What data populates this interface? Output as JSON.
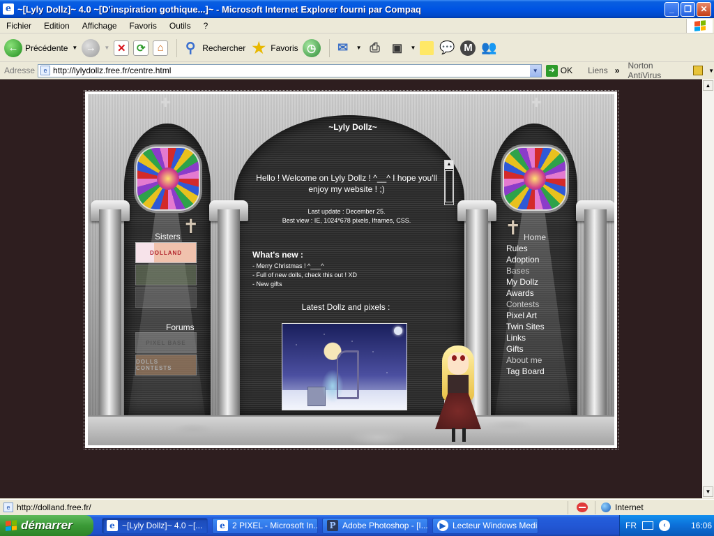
{
  "window": {
    "title": "~[Lyly Dollz]~ 4.0 ~[D'inspiration gothique...]~ - Microsoft Internet Explorer fourni par Compaq"
  },
  "menu": [
    "Fichier",
    "Edition",
    "Affichage",
    "Favoris",
    "Outils",
    "?"
  ],
  "toolbar": {
    "back_label": "Précédente",
    "search_label": "Rechercher",
    "favorites_label": "Favoris"
  },
  "address": {
    "label": "Adresse",
    "url": "http://lylydollz.free.fr/centre.html",
    "go_label": "OK",
    "links_label": "Liens",
    "norton_label": "Norton AntiVirus"
  },
  "page": {
    "site_title": "~Lyly Dollz~",
    "welcome": "Hello ! Welcome on Lyly Dollz ! ^__^ I hope you'll enjoy my website ! ;)",
    "last_update": "Last update : December 25.",
    "best_view": "Best view : IE, 1024*678 pixels, Iframes, CSS.",
    "whats_new_heading": "What's new :",
    "news": [
      "- Merry Christmas ! ^___^",
      "- Full of new dolls, check this out ! XD",
      "- New gifts"
    ],
    "latest_heading": "Latest Dollz and pixels :",
    "sisters_label": "Sisters",
    "forums_label": "Forums",
    "sister_banners": [
      "DOLLAND",
      "",
      ""
    ],
    "forum_banners": [
      "PIXEL BASE",
      "DOLLS CONTESTS"
    ],
    "nav": [
      {
        "label": "Home",
        "dim": true
      },
      {
        "label": "Rules",
        "dim": false
      },
      {
        "label": "Adoption",
        "dim": false
      },
      {
        "label": "Bases",
        "dim": true
      },
      {
        "label": "My Dollz",
        "dim": false
      },
      {
        "label": "Awards",
        "dim": false
      },
      {
        "label": "Contests",
        "dim": true
      },
      {
        "label": "Pixel Art",
        "dim": false
      },
      {
        "label": "Twin Sites",
        "dim": false
      },
      {
        "label": "Links",
        "dim": false
      },
      {
        "label": "Gifts",
        "dim": false
      },
      {
        "label": "About me",
        "dim": true
      },
      {
        "label": "Tag Board",
        "dim": false
      }
    ]
  },
  "status": {
    "text": "http://dolland.free.fr/",
    "zone": "Internet"
  },
  "taskbar": {
    "start_label": "démarrer",
    "tasks": [
      {
        "label": "~[Lyly Dollz]~ 4.0 ~[...",
        "active": true
      },
      {
        "label": "2 PIXEL - Microsoft In...",
        "active": false
      },
      {
        "label": "Adobe Photoshop - [I...",
        "active": false
      },
      {
        "label": "Lecteur Windows Media",
        "active": false
      }
    ],
    "lang": "FR",
    "clock": "16:06"
  }
}
